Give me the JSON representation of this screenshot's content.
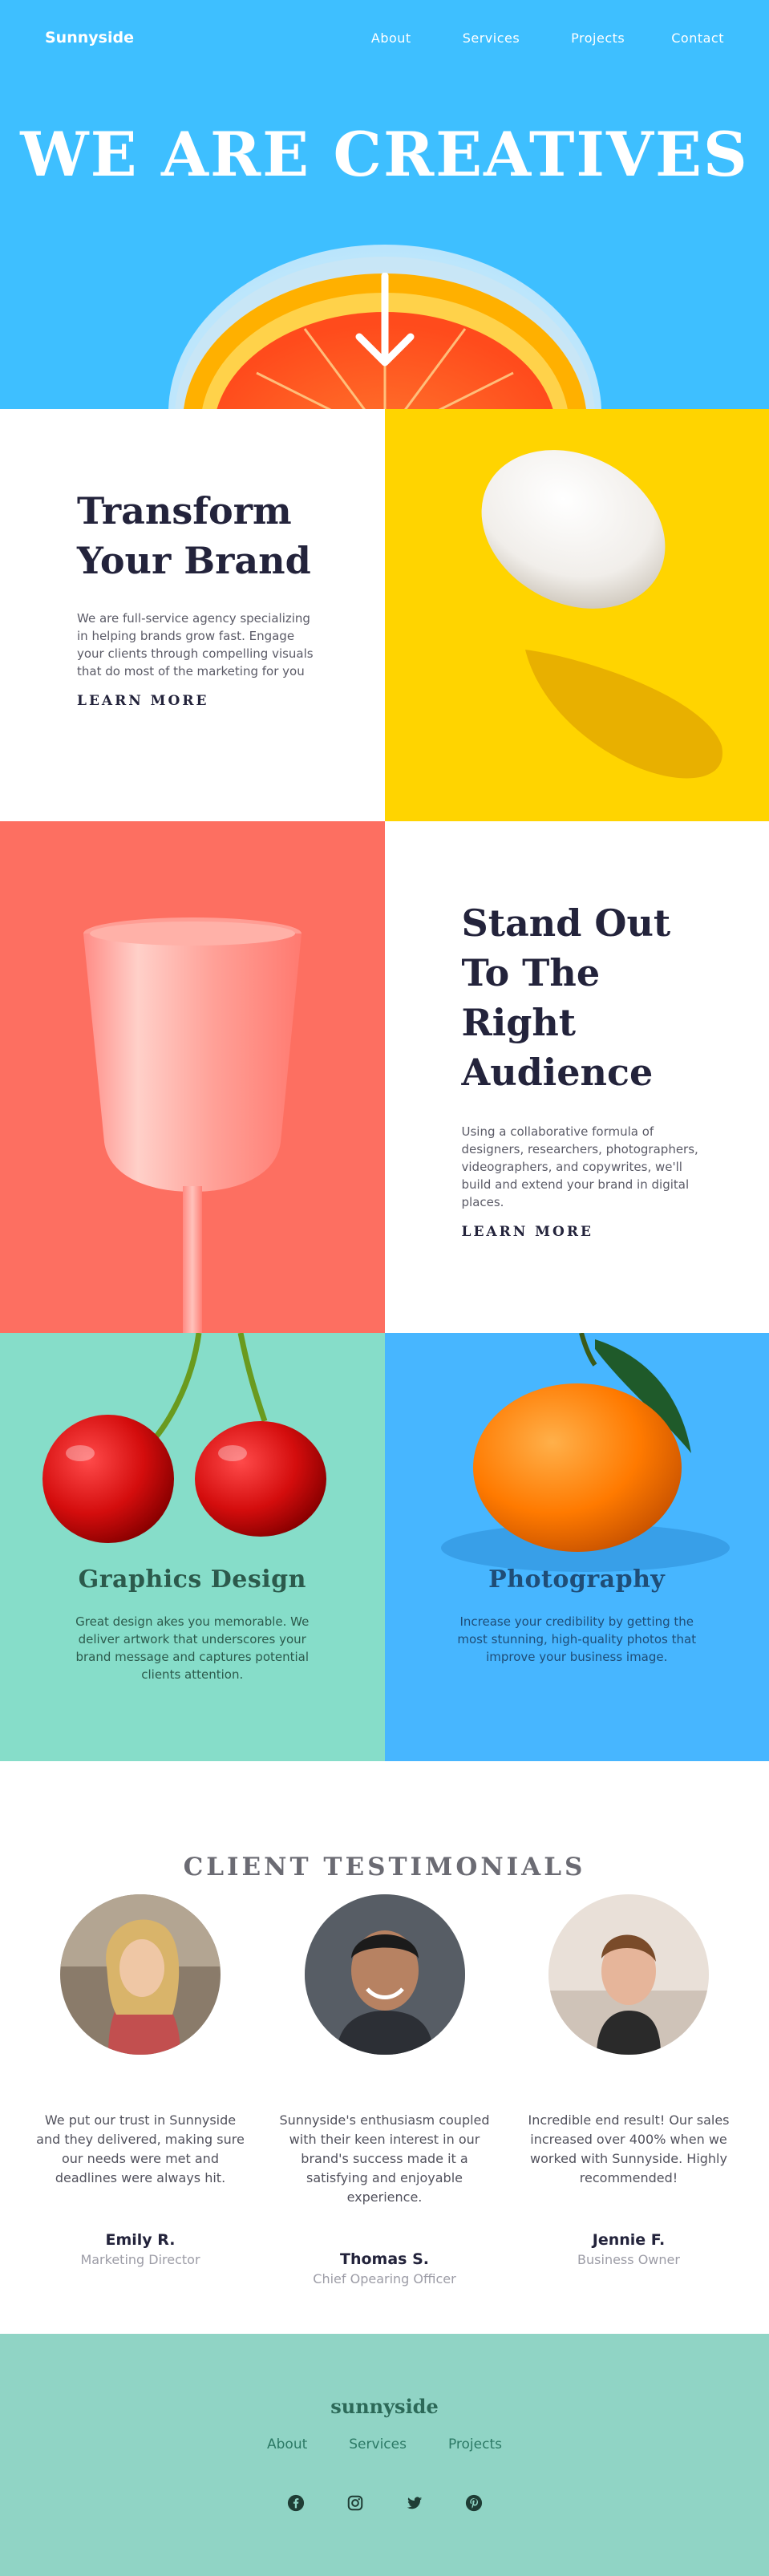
{
  "header": {
    "logo": "Sunnyside",
    "nav": [
      "About",
      "Services",
      "Projects",
      "Contact"
    ]
  },
  "hero": {
    "title": "WE ARE CREATIVES",
    "arrow_icon": "arrow-down-icon"
  },
  "features": [
    {
      "title_lines": [
        "Transform",
        "Your Brand"
      ],
      "body": "We are full-service agency specializing in helping brands grow fast. Engage your clients through compelling visuals that do most of the marketing for you",
      "link": "LEARN MORE",
      "image": "egg"
    },
    {
      "title_lines": [
        "Stand Out",
        "To The",
        "Right",
        "Audience"
      ],
      "body": "Using a collaborative formula of designers, researchers, photographers, videographers, and copywrites, we'll build and extend your brand in digital places.",
      "link": "LEARN MORE",
      "image": "cup"
    }
  ],
  "cards": [
    {
      "title": "Graphics Design",
      "text": "Great design akes you memorable. We deliver artwork that underscores your brand message and captures potential clients attention.",
      "image": "cherries"
    },
    {
      "title": "Photography",
      "text": "Increase your credibility by getting the most stunning, high-quality photos that improve your business image.",
      "image": "orange"
    }
  ],
  "testimonials": {
    "heading": "CLIENT TESTIMONIALS",
    "items": [
      {
        "quote": "We put our trust in Sunnyside and they delivered, making sure our needs were met and deadlines were always hit.",
        "name": "Emily R.",
        "role": "Marketing Director"
      },
      {
        "quote": "Sunnyside's enthusiasm coupled with their keen interest in our brand's success made it a satisfying and enjoyable experience.",
        "name": "Thomas S.",
        "role": "Chief Opearing Officer"
      },
      {
        "quote": "Incredible end result! Our sales increased over 400% when we worked with Sunnyside. Highly recommended!",
        "name": "Jennie F.",
        "role": "Business Owner"
      }
    ]
  },
  "footer": {
    "logo": "sunnyside",
    "links": [
      "About",
      "Services",
      "Projects"
    ],
    "social_icons": [
      "facebook-icon",
      "instagram-icon",
      "twitter-icon",
      "pinterest-icon"
    ]
  },
  "colors": {
    "hero_bg": "#3ebfff",
    "egg_bg": "#ffd400",
    "cup_bg": "#fd6f61",
    "cherry_bg": "#86ddc9",
    "orange_bg": "#47b6ff",
    "footer_bg": "#90d4c5",
    "dark_text": "#23233b"
  }
}
